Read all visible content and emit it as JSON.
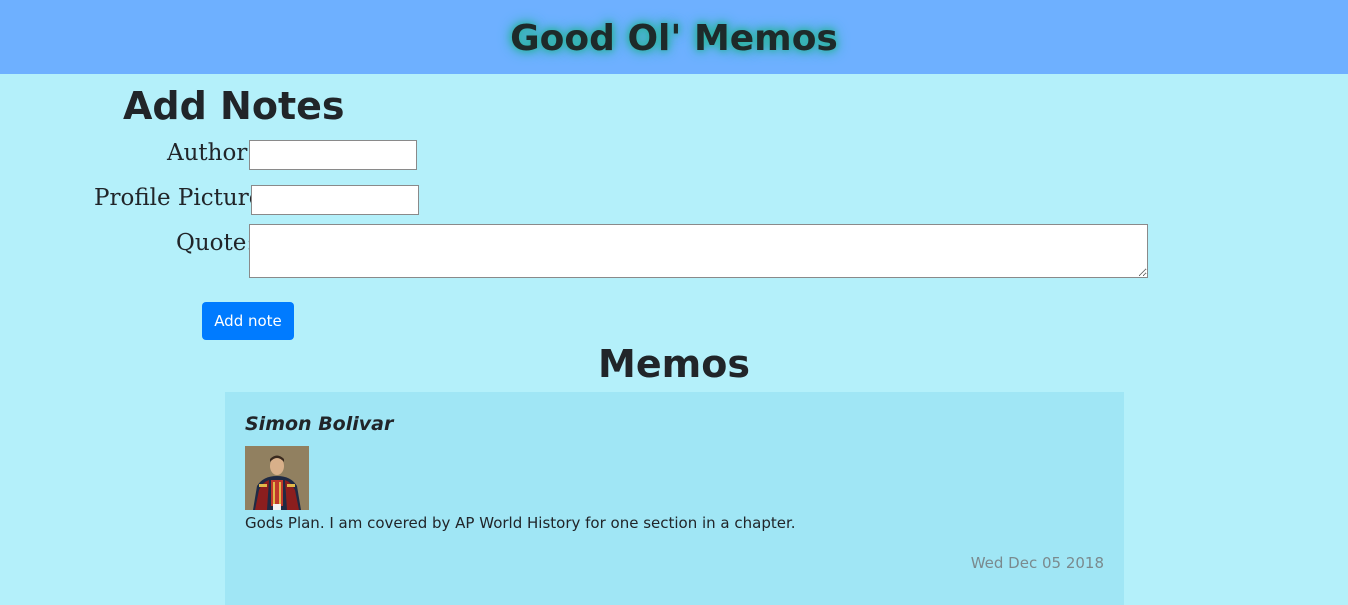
{
  "header": {
    "title": "Good Ol' Memos"
  },
  "form": {
    "title": "Add Notes",
    "author_label": "Author:",
    "author_value": "",
    "profile_label": "Profile Picture:",
    "profile_value": "",
    "quote_label": "Quote:",
    "quote_value": "",
    "submit_label": "Add note"
  },
  "memos": {
    "title": "Memos",
    "items": [
      {
        "author": "Simon Bolivar",
        "avatar": "portrait-image",
        "quote": "Gods Plan. I am covered by AP World History for one section in a chapter.",
        "date": "Wed Dec 05 2018"
      }
    ]
  },
  "colors": {
    "page_background": "#b4f0fa",
    "header_background": "#6eb0ff",
    "title_glow": "#2fb3a8",
    "button_primary": "#007bff",
    "card_background": "#a0e6f5",
    "date_text": "#7a8a8e"
  }
}
